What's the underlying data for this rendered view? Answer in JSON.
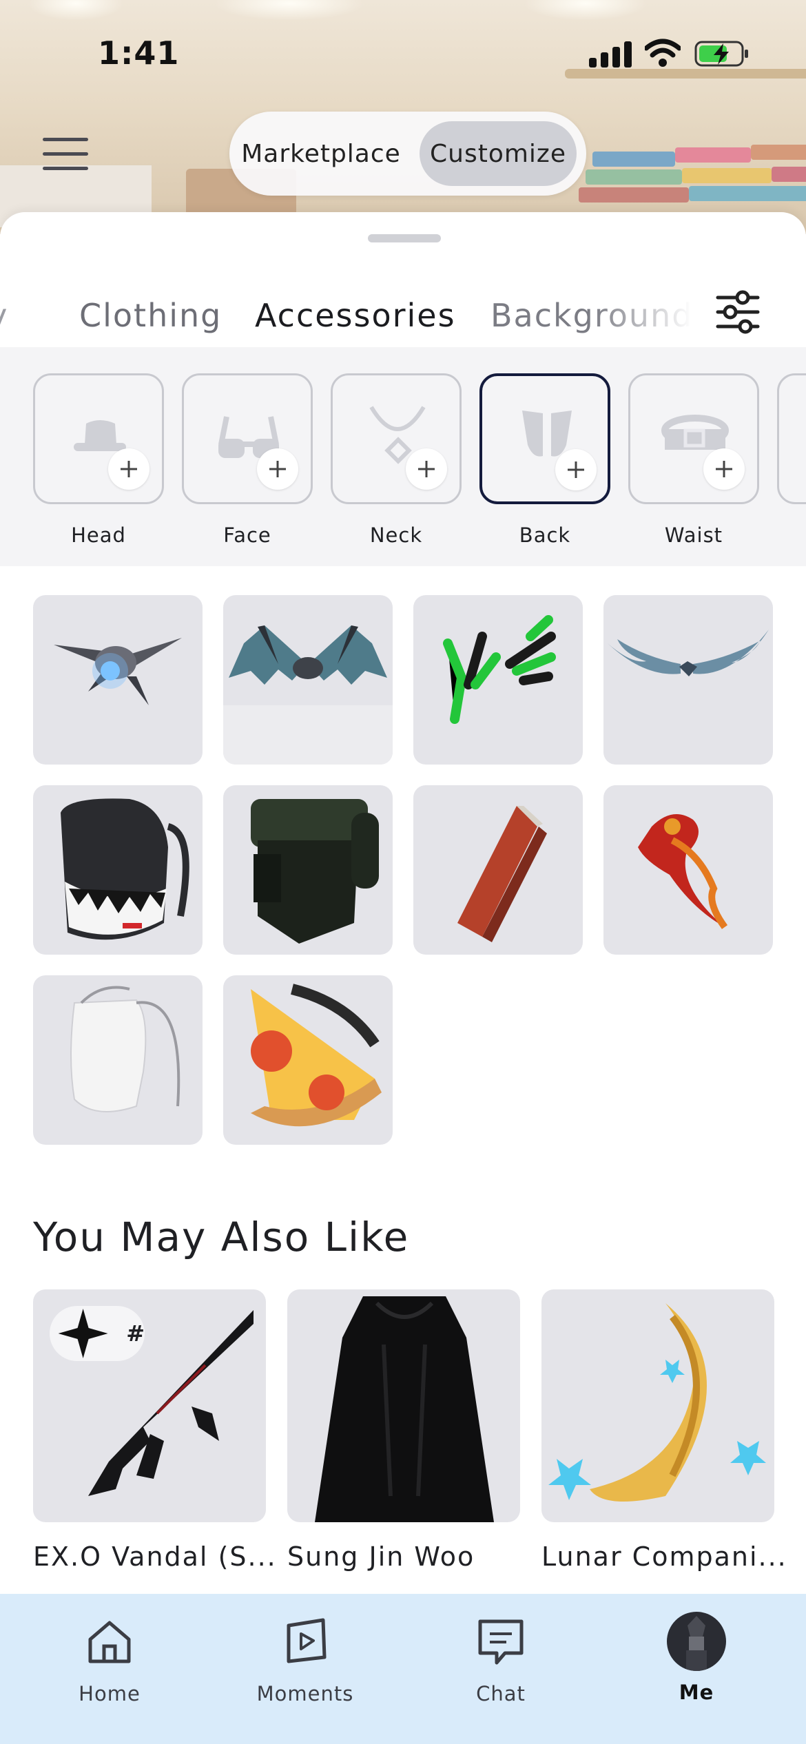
{
  "status_bar": {
    "time": "1:41"
  },
  "top_toggle": {
    "marketplace": "Marketplace",
    "customize": "Customize",
    "selected": "Customize"
  },
  "tabs": {
    "items": [
      "dy",
      "Clothing",
      "Accessories",
      "Backgrounds"
    ],
    "selected": "Accessories"
  },
  "categories": [
    {
      "label": "Head",
      "icon": "hat-icon"
    },
    {
      "label": "Face",
      "icon": "glasses-icon"
    },
    {
      "label": "Neck",
      "icon": "necklace-icon"
    },
    {
      "label": "Back",
      "icon": "back-icon",
      "selected": true
    },
    {
      "label": "Waist",
      "icon": "belt-icon"
    }
  ],
  "items": [
    {
      "name": "drone-wings-item"
    },
    {
      "name": "bat-wings-item"
    },
    {
      "name": "green-claws-item"
    },
    {
      "name": "blue-wings-item"
    },
    {
      "name": "shark-backpack-item"
    },
    {
      "name": "green-armor-backpack-item"
    },
    {
      "name": "red-guitar-case-item"
    },
    {
      "name": "red-dragon-item"
    },
    {
      "name": "white-bag-item"
    },
    {
      "name": "pizza-slice-backpack-item"
    }
  ],
  "recommendations": {
    "title": "You May Also Like",
    "items": [
      {
        "name": "EX.O Vandal (S...",
        "badge": "#"
      },
      {
        "name": "Sung Jin Woo"
      },
      {
        "name": "Lunar Compani..."
      }
    ]
  },
  "bottom_nav": {
    "items": [
      {
        "label": "Home",
        "icon": "home-icon"
      },
      {
        "label": "Moments",
        "icon": "moments-icon"
      },
      {
        "label": "Chat",
        "icon": "chat-icon"
      },
      {
        "label": "Me",
        "icon": "avatar",
        "active": true
      }
    ]
  },
  "colors": {
    "selected_tab_underline": "#1b1c20",
    "selected_category_border": "#141b3d",
    "bottom_nav_bg": "#d9ebfa",
    "tile_bg": "#e4e4e9"
  }
}
